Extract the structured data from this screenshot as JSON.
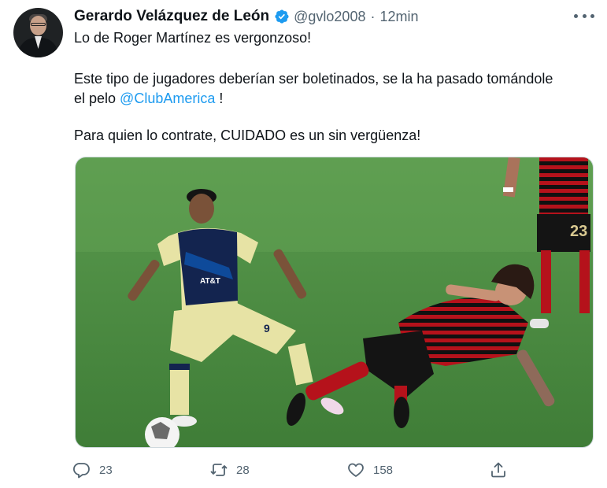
{
  "author": {
    "name": "Gerardo Velázquez de León",
    "handle": "@gvlo2008",
    "separator": "·",
    "time": "12min"
  },
  "tweet": {
    "line1": "Lo de Roger Martínez es vergonzoso!",
    "line2": "Este tipo de jugadores deberían ser boletinados, se la ha pasado tomándole",
    "line3_prefix": "el pelo ",
    "line3_mention": "@ClubAmerica",
    "line3_suffix": " !",
    "line4": "Para quien lo contrate, CUIDADO es un sin vergüenza!"
  },
  "media": {
    "jersey_number_left": "9",
    "jersey_number_right": "23",
    "sponsor": "AT&T"
  },
  "actions": {
    "reply_count": "23",
    "retweet_count": "28",
    "like_count": "158"
  },
  "icons": {
    "verified": "verified-badge-icon",
    "more": "more-icon",
    "reply": "reply-icon",
    "retweet": "retweet-icon",
    "like": "like-icon",
    "share": "share-icon"
  },
  "colors": {
    "accent": "#1d9bf0",
    "secondary_text": "#536471",
    "primary_text": "#0f1419"
  }
}
